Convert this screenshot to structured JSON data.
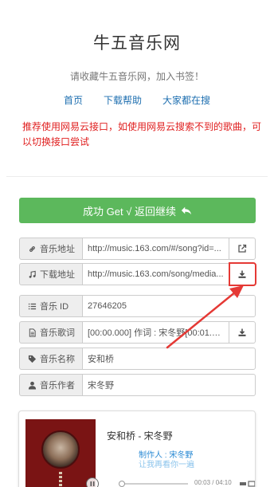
{
  "header": {
    "title": "牛五音乐网",
    "subtitle": "请收藏牛五音乐网，加入书签！"
  },
  "nav": [
    {
      "label": "首页"
    },
    {
      "label": "下载帮助"
    },
    {
      "label": "大家都在搜"
    }
  ],
  "notice": "推荐使用网易云接口，如使用网易云搜索不到的歌曲，可以切换接口尝试",
  "success_button": {
    "label": "成功 Get √ 返回继续"
  },
  "fields": {
    "music_url": {
      "label": "音乐地址",
      "value": "http://music.163.com/#/song?id=..."
    },
    "download_url": {
      "label": "下载地址",
      "value": "http://music.163.com/song/media..."
    },
    "music_id": {
      "label": "音乐 ID",
      "value": "27646205"
    },
    "lyrics": {
      "label": "音乐歌词",
      "value": "[00:00.000] 作词 : 宋冬野[00:01.00..."
    },
    "name": {
      "label": "音乐名称",
      "value": "安和桥"
    },
    "author": {
      "label": "音乐作者",
      "value": "宋冬野"
    }
  },
  "player": {
    "title": "安和桥 - 宋冬野",
    "lyric_line1": "制作人 : 宋冬野",
    "lyric_line2": "让我再看你一遍",
    "time": "00:03 / 04:10",
    "progress": 0
  },
  "colors": {
    "success": "#5cb85c",
    "link": "#1e6fb0",
    "notice": "#e02020",
    "annotation": "#e53935"
  }
}
